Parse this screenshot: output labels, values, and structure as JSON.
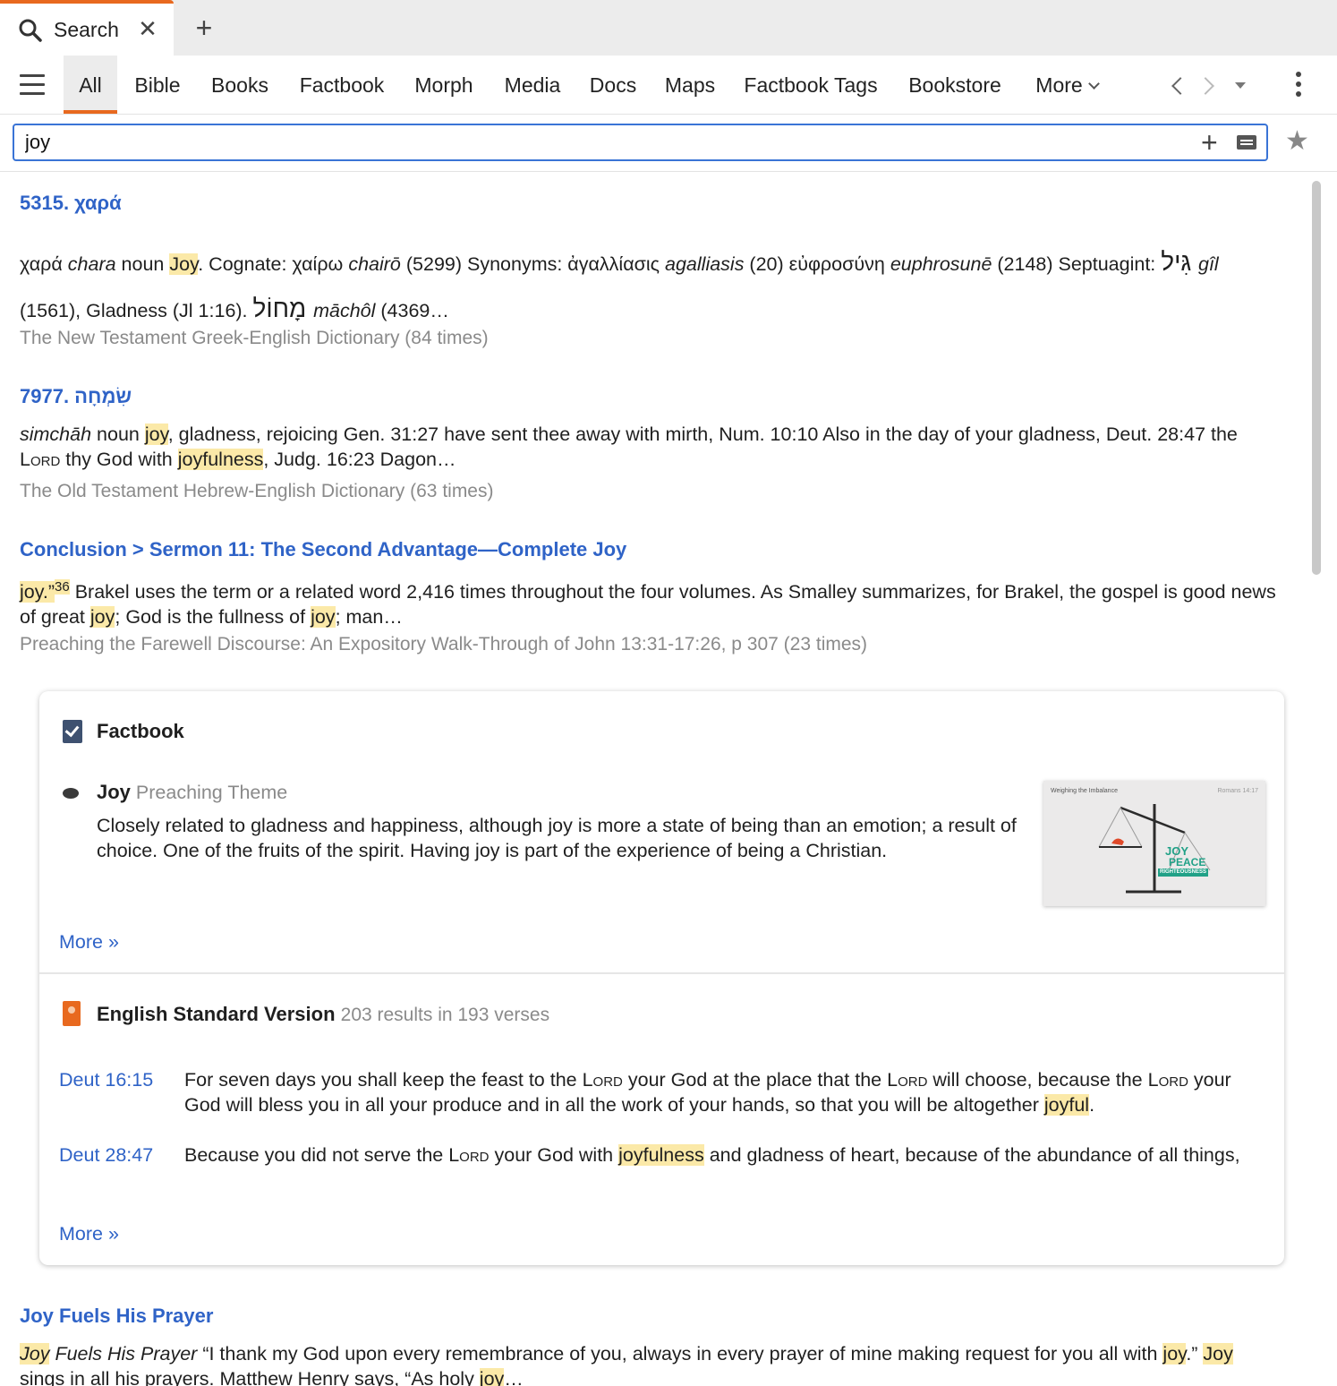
{
  "tab": {
    "label": "Search",
    "close": "✕",
    "add": "+"
  },
  "categories": {
    "all": "All",
    "bible": "Bible",
    "books": "Books",
    "factbook": "Factbook",
    "morph": "Morph",
    "media": "Media",
    "docs": "Docs",
    "maps": "Maps",
    "factbook_tags": "Factbook Tags",
    "bookstore": "Bookstore",
    "more": "More"
  },
  "search": {
    "value": "joy",
    "plus": "+"
  },
  "results": [
    {
      "title": "5315. χαρά",
      "source": "The New Testament Greek-English Dictionary (84 times)"
    },
    {
      "title": "7977. שִׂמְחָה",
      "source": "The Old Testament Hebrew-English Dictionary (63 times)"
    },
    {
      "title": "Conclusion > Sermon 11: The Second Advantage—Complete Joy",
      "source": "Preaching the Farewell Discourse: An Expository Walk-Through of John 13:31-17:26, p 307 (23 times)"
    }
  ],
  "texts": {
    "r1_a": "χαρά ",
    "r1_b": "chara",
    "r1_c": " noun ",
    "r1_d": "Joy",
    "r1_e": ". Cognate: χαίρω ",
    "r1_f": "chairō",
    "r1_g": " (5299) Synonyms: ἀγαλλίασις ",
    "r1_h": "agalliasis",
    "r1_i": " (20) εὐφροσύνη ",
    "r1_j": "euphrosunē",
    "r1_k": " (2148) Septuagint: ",
    "r1_l": "גִּיל ",
    "r1_m": "gîl",
    "r1_n": "(1561), Gladness (Jl 1:16). ",
    "r1_o": "מָחוֹל ",
    "r1_p": "māchôl",
    "r1_q": " (4369…",
    "r2_a": "simchāh",
    "r2_b": " noun ",
    "r2_c": "joy",
    "r2_d": ", gladness, rejoicing Gen. 31:27 have sent thee away with mirth, Num. 10:10 Also in the day of your gladness, Deut. 28:47 the ",
    "r2_e": "Lord",
    "r2_f": " thy God with ",
    "r2_g": "joyfulness",
    "r2_h": ", Judg. 16:23 Dagon…",
    "r3_a": "joy.”",
    "r3_b": "36",
    "r3_c": " Brakel uses the term or a related word 2,416 times throughout the four volumes. As Smalley summarizes, for Brakel, the gospel is good news of great ",
    "r3_d": "joy",
    "r3_e": "; God is the fullness of ",
    "r3_f": "joy",
    "r3_g": "; man…"
  },
  "factbook": {
    "heading": "Factbook",
    "entry_title": "Joy",
    "entry_type": "Preaching Theme",
    "entry_desc": "Closely related to gladness and happiness, although joy is more a state of being than an emotion; a result of choice. One of the fruits of the spirit. Having joy is part of the experience of being a Christian.",
    "thumb_caption": "Weighing the Imbalance",
    "thumb_ref": "Romans 14:17",
    "thumb_words": [
      "JOY",
      "PEACE",
      "RIGHTEOUSNESS"
    ],
    "more": "More »"
  },
  "esv": {
    "heading": "English Standard Version",
    "count": "203 results in 193 verses",
    "more": "More »",
    "v1_ref": "Deut 16:15",
    "v1_a": "For seven days you shall keep the feast to the ",
    "v1_b": "Lord",
    "v1_c": " your God at the place that the ",
    "v1_d": "Lord",
    "v1_e": " will choose, because the ",
    "v1_f": "Lord",
    "v1_g": " your God will bless you in all your produce and in all the work of your hands, so that you will be altogether ",
    "v1_h": "joyful",
    "v1_i": ".",
    "v2_ref": "Deut 28:47",
    "v2_a": "Because you did not serve the ",
    "v2_b": "Lord",
    "v2_c": " your God with ",
    "v2_d": "joyfulness",
    "v2_e": " and gladness of heart, because of the abundance of all things,"
  },
  "result4": {
    "title": "Joy Fuels His Prayer",
    "a": "Joy",
    "b": " Fuels His Prayer",
    "c": " “I thank my God upon every remembrance of you, always in every prayer of mine making request for you all with ",
    "d": "joy",
    "e": ".” ",
    "f": "Joy",
    "g": " sings in all his prayers. Matthew Henry says, “As holy ",
    "h": "joy",
    "i": "…"
  },
  "colors": {
    "accent": "#e8691f",
    "link": "#2f63c7",
    "highlight": "#fbe9a8",
    "focus": "#3a74d6"
  },
  "icons": [
    "search-icon",
    "close-icon",
    "plus-icon",
    "hamburger-icon",
    "chevron-down-icon",
    "back-icon",
    "forward-icon",
    "dropdown-icon",
    "kebab-icon",
    "keyboard-icon",
    "star-icon",
    "factbook-icon",
    "bullet-icon",
    "book-icon"
  ]
}
